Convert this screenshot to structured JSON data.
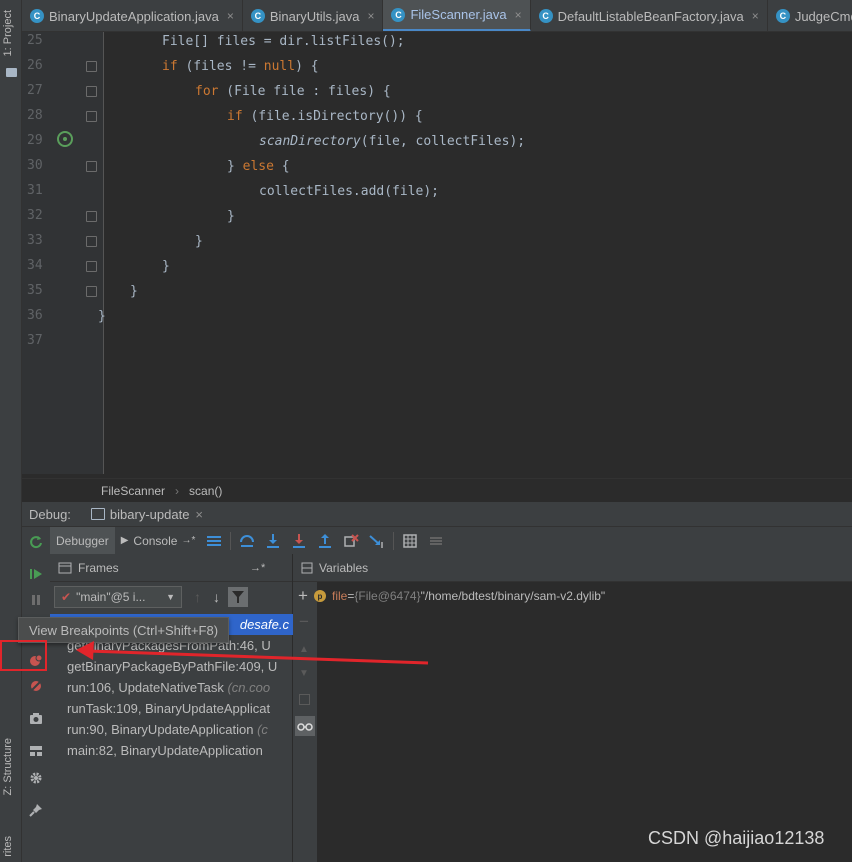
{
  "sidebar": {
    "project_label": "1: Project",
    "structure_label": "Z: Structure",
    "favorites_label": "rites"
  },
  "tabs": [
    {
      "label": "BinaryUpdateApplication.java",
      "active": false
    },
    {
      "label": "BinaryUtils.java",
      "active": false
    },
    {
      "label": "FileScanner.java",
      "active": true
    },
    {
      "label": "DefaultListableBeanFactory.java",
      "active": false
    },
    {
      "label": "JudgeCmdO",
      "active": false
    }
  ],
  "editor": {
    "line_numbers": [
      "25",
      "26",
      "27",
      "28",
      "29",
      "30",
      "31",
      "32",
      "33",
      "34",
      "35",
      "36",
      "37"
    ],
    "code": {
      "l25": "File[] files = dir.listFiles();",
      "l26_kw": "if",
      "l26_open": " (files != ",
      "l26_null": "null",
      "l26_close": ") {",
      "l27_kw": "for",
      "l27_rest": " (File file : files) {",
      "l28_kw": "if",
      "l28_rest": " (file.isDirectory()) {",
      "l29_method": "scanDirectory",
      "l29_rest": "(file, collectFiles);",
      "l30_brace": "} ",
      "l30_kw": "else",
      "l30_rest": " {",
      "l31": "collectFiles.add(file);",
      "l32": "}",
      "l33": "}",
      "l34": "}",
      "l35": "}",
      "l36": "}"
    }
  },
  "breadcrumb": {
    "class": "FileScanner",
    "sep": "›",
    "method": "scan()"
  },
  "debug": {
    "label": "Debug:",
    "session": "bibary-update",
    "close": "×",
    "debugger_tab": "Debugger",
    "console_tab": "Console",
    "frames_label": "Frames",
    "variables_label": "Variables",
    "thread": "\"main\"@5 i...",
    "frames": [
      "desafe.c",
      "getBinaryPackagesFromPath:46, U",
      "getBinaryPackageByPathFile:409, U",
      {
        "text": "run:106, UpdateNativeTask ",
        "pkg": "(cn.coo"
      },
      "runTask:109, BinaryUpdateApplicat",
      {
        "text": "run:90, BinaryUpdateApplication ",
        "pkg": "(c"
      },
      "main:82, BinaryUpdateApplication"
    ],
    "variable": {
      "badge": "p",
      "name": "file",
      "eq": " = ",
      "ref": "{File@6474} ",
      "value": "\"/home/bdtest/binary/sam-v2.dylib\""
    }
  },
  "tooltip": "View Breakpoints (Ctrl+Shift+F8)",
  "watermark": "CSDN @haijiao12138",
  "colors": {
    "accent": "#4a88c7",
    "keyword": "#cc7832",
    "annotation_red": "#e1252b",
    "selection": "#2f65ca"
  }
}
